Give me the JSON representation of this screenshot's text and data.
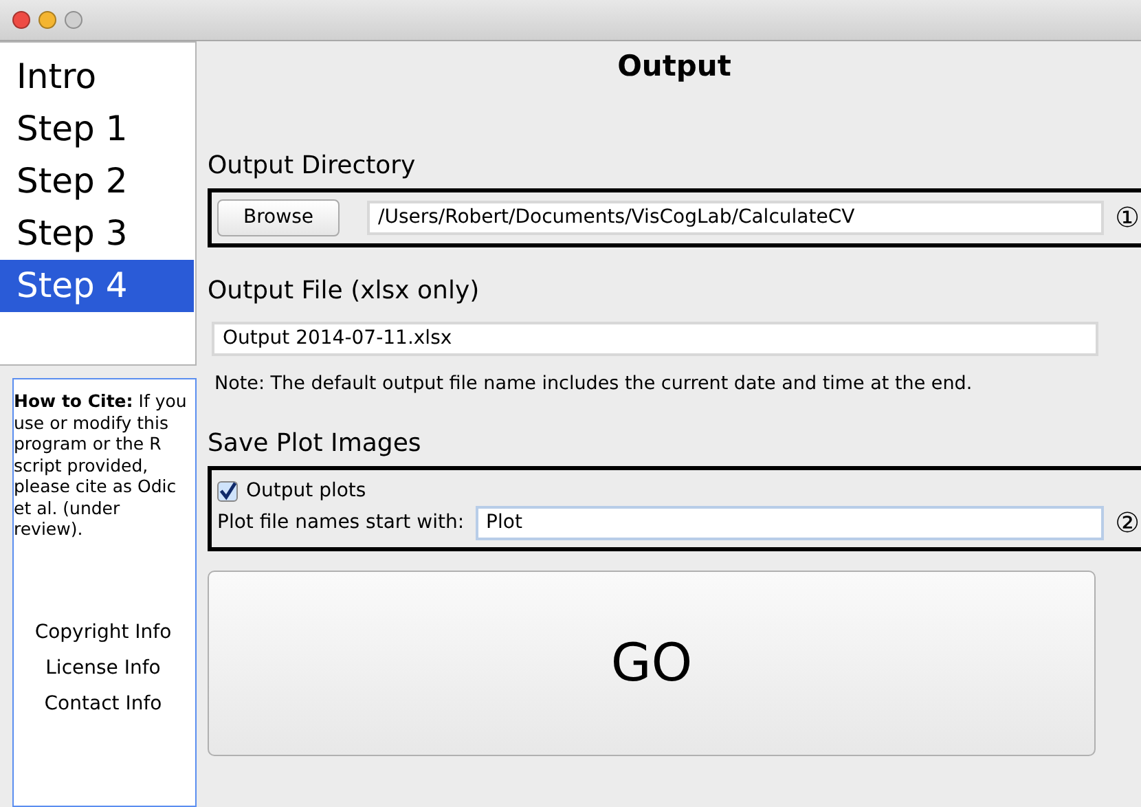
{
  "nav": {
    "items": [
      {
        "label": "Intro",
        "selected": false
      },
      {
        "label": "Step 1",
        "selected": false
      },
      {
        "label": "Step 2",
        "selected": false
      },
      {
        "label": "Step 3",
        "selected": false
      },
      {
        "label": "Step 4",
        "selected": true
      }
    ]
  },
  "cite": {
    "text": "**How to Cite:** If you use or modify this program or the R script provided, please cite as Odic et al. (under review).",
    "links": [
      "Copyright Info",
      "License Info",
      "Contact Info"
    ]
  },
  "page_title": "Output",
  "sections": [
    {
      "kind": "directory",
      "heading": "Output Directory",
      "button": "Browse",
      "value": "/Users/Robert/Documents/VisCogLab/CalculateCV",
      "marker": "①"
    },
    {
      "kind": "file",
      "heading": "Output File (xlsx only)",
      "value": "Output 2014-07-11.xlsx",
      "note": "Note: The default output file name includes the current date and time at the end."
    },
    {
      "kind": "plots",
      "heading": "Save Plot Images",
      "checkbox": {
        "label": "Output plots",
        "checked": true
      },
      "field_label": "Plot file names start with:",
      "value": "Plot",
      "marker": "②"
    }
  ],
  "go_button": "GO"
}
